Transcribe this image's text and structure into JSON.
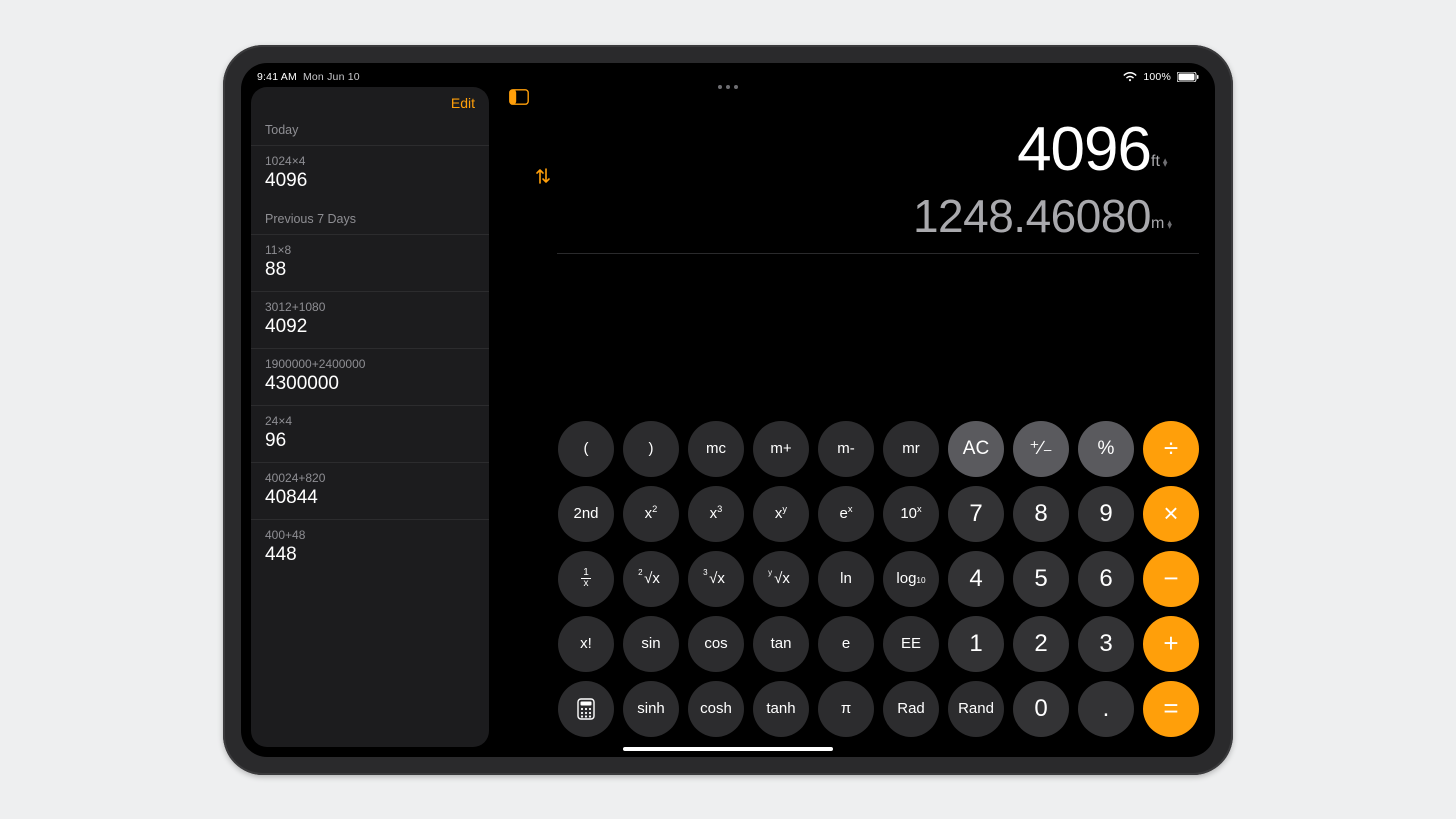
{
  "status": {
    "time": "9:41 AM",
    "date": "Mon Jun 10",
    "battery": "100%"
  },
  "sidebar": {
    "edit_label": "Edit",
    "sections": [
      {
        "label": "Today",
        "items": [
          {
            "expr": "1024×4",
            "result": "4096"
          }
        ]
      },
      {
        "label": "Previous 7 Days",
        "items": [
          {
            "expr": "11×8",
            "result": "88"
          },
          {
            "expr": "3012+1080",
            "result": "4092"
          },
          {
            "expr": "1900000+2400000",
            "result": "4300000"
          },
          {
            "expr": "24×4",
            "result": "96"
          },
          {
            "expr": "40024+820",
            "result": "40844"
          },
          {
            "expr": "400+48",
            "result": "448"
          }
        ]
      }
    ]
  },
  "display": {
    "primary_value": "4096",
    "primary_unit": "ft",
    "secondary_value": "1248.46080",
    "secondary_unit": "m"
  },
  "keys": {
    "r0": {
      "paren_open": "(",
      "paren_close": ")",
      "mc": "mc",
      "mplus": "m+",
      "mminus": "m-",
      "mr": "mr",
      "ac": "AC",
      "sign": "⁺∕₋",
      "percent": "%",
      "divide": "÷"
    },
    "r1": {
      "second": "2nd",
      "x2": "x",
      "x3": "x",
      "xy": "x",
      "ex": "e",
      "tenx": "10",
      "n7": "7",
      "n8": "8",
      "n9": "9",
      "times": "×"
    },
    "r2": {
      "inv": "1/x",
      "sqrt": "√x",
      "cbrt": "√x",
      "yroot": "√x",
      "ln": "ln",
      "log10": "log",
      "n4": "4",
      "n5": "5",
      "n6": "6",
      "minus": "−"
    },
    "r3": {
      "fact": "x!",
      "sin": "sin",
      "cos": "cos",
      "tan": "tan",
      "e": "e",
      "ee": "EE",
      "n1": "1",
      "n2": "2",
      "n3": "3",
      "plus": "+"
    },
    "r4": {
      "sinh": "sinh",
      "cosh": "cosh",
      "tanh": "tanh",
      "pi": "π",
      "rad": "Rad",
      "rand": "Rand",
      "n0": "0",
      "dot": ".",
      "eq": "="
    }
  }
}
